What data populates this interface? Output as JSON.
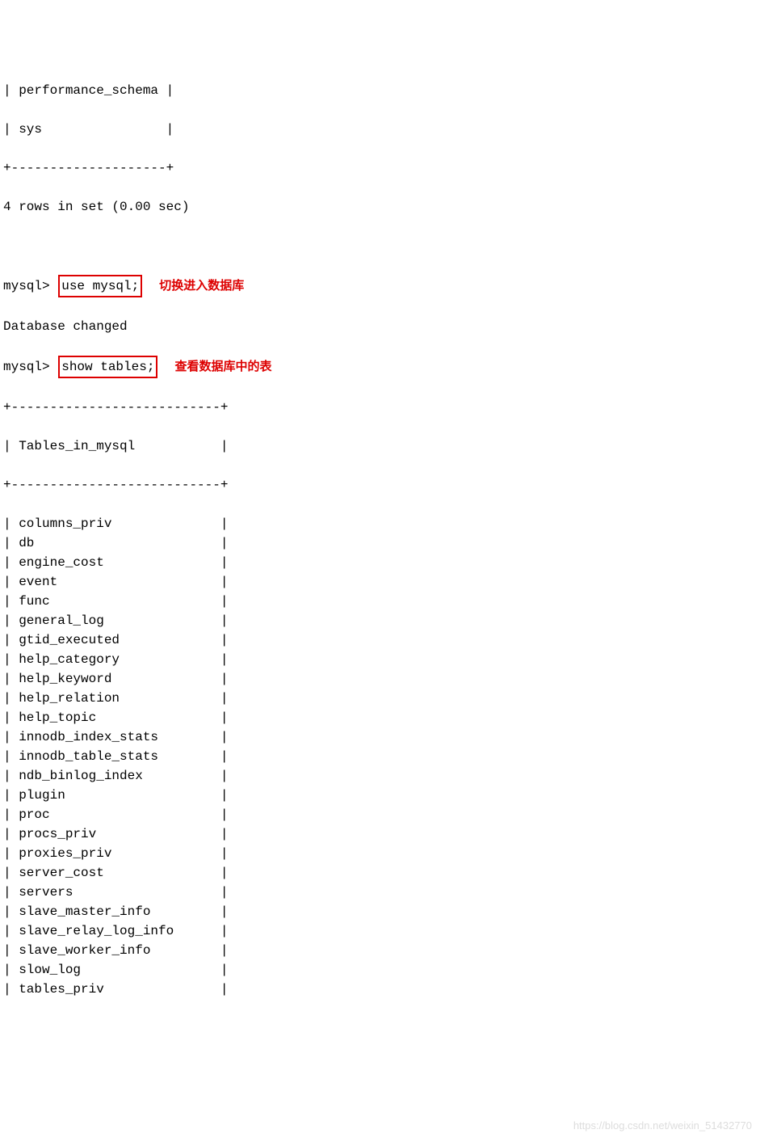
{
  "top_rows": [
    "| performance_schema |",
    "| sys                |",
    "+--------------------+"
  ],
  "row_count_line": "4 rows in set (0.00 sec)",
  "prompt": "mysql>",
  "cmd1": "use mysql;",
  "annotation1": "切换进入数据库",
  "db_changed": "Database changed",
  "cmd2": "show tables;",
  "annotation2": "查看数据库中的表",
  "table_border": "+---------------------------+",
  "table_header": "| Tables_in_mysql           |",
  "tables": [
    "| columns_priv              |",
    "| db                        |",
    "| engine_cost               |",
    "| event                     |",
    "| func                      |",
    "| general_log               |",
    "| gtid_executed             |",
    "| help_category             |",
    "| help_keyword              |",
    "| help_relation             |",
    "| help_topic                |",
    "| innodb_index_stats        |",
    "| innodb_table_stats        |",
    "| ndb_binlog_index          |",
    "| plugin                    |",
    "| proc                      |",
    "| procs_priv                |",
    "| proxies_priv              |",
    "| server_cost               |",
    "| servers                   |",
    "| slave_master_info         |",
    "| slave_relay_log_info      |",
    "| slave_worker_info         |",
    "| slow_log                  |",
    "| tables_priv               |"
  ],
  "watermark": "https://blog.csdn.net/weixin_51432770"
}
